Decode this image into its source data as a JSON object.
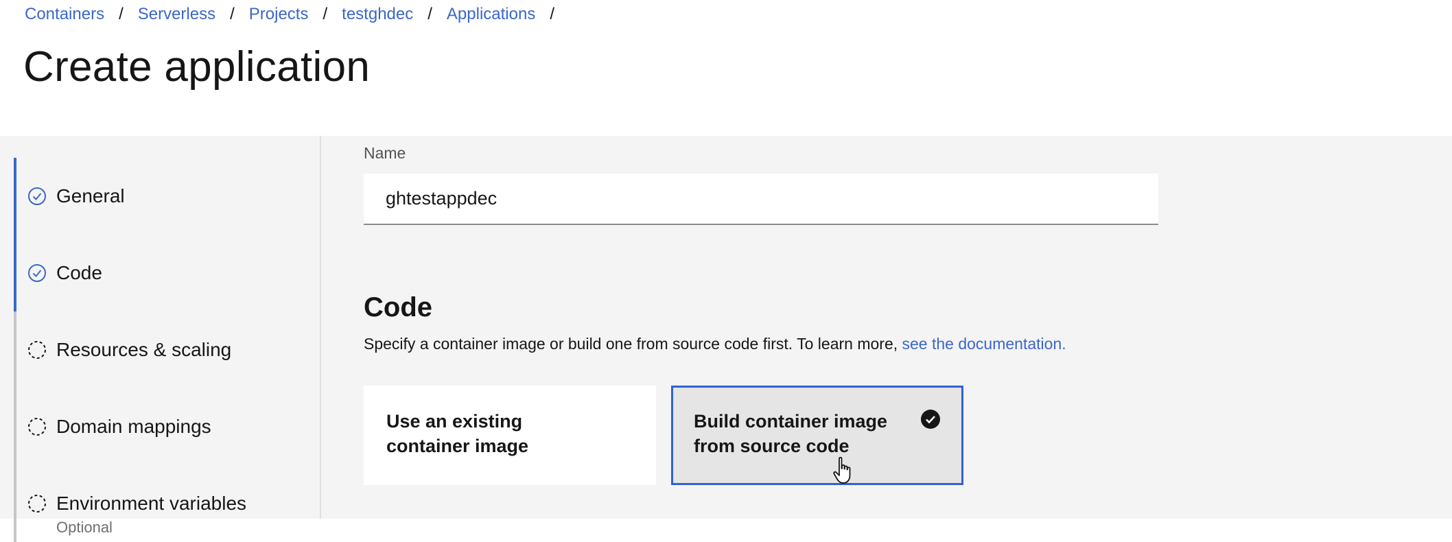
{
  "breadcrumb": {
    "items": [
      "Containers",
      "Serverless",
      "Projects",
      "testghdec",
      "Applications"
    ],
    "separator": "/"
  },
  "page": {
    "title": "Create application"
  },
  "sidebar": {
    "steps": [
      {
        "label": "General",
        "status": "complete",
        "icon": "checkmark-outline-icon"
      },
      {
        "label": "Code",
        "status": "complete",
        "icon": "checkmark-outline-icon"
      },
      {
        "label": "Resources & scaling",
        "status": "incomplete",
        "icon": "circle-dash-icon"
      },
      {
        "label": "Domain mappings",
        "status": "incomplete",
        "icon": "circle-dash-icon"
      },
      {
        "label": "Environment variables",
        "sublabel": "Optional",
        "status": "incomplete",
        "icon": "circle-dash-icon"
      }
    ]
  },
  "form": {
    "name_label": "Name",
    "name_value": "ghtestappdec",
    "code": {
      "title": "Code",
      "description": "Specify a container image or build one from source code first. To learn more, ",
      "link_text": "see the documentation.",
      "tiles": [
        {
          "label": "Use an existing container image",
          "selected": false
        },
        {
          "label": "Build container image from source code",
          "selected": true
        }
      ]
    }
  },
  "colors": {
    "link": "#3b67c9",
    "selected_border": "#2f61d3",
    "background": "#f4f4f4",
    "text": "#161616"
  }
}
